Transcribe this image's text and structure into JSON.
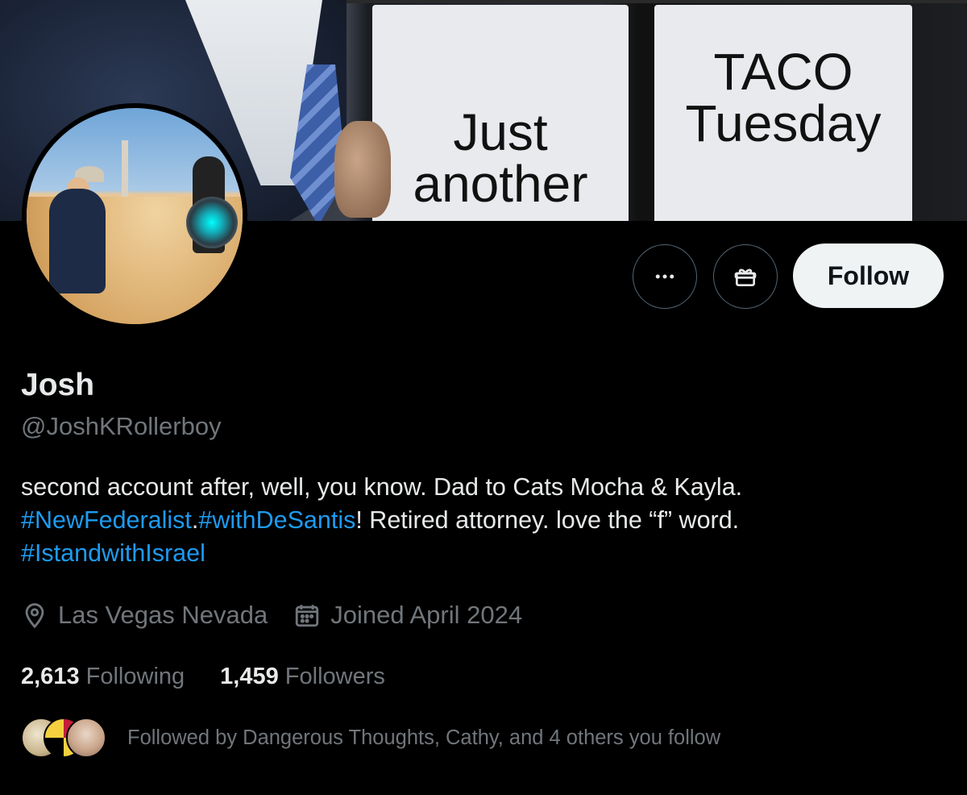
{
  "banner": {
    "sign_left_line1": "Just",
    "sign_left_line2": "another",
    "sign_right_line1": "TACO",
    "sign_right_line2": "Tuesday"
  },
  "actions": {
    "more_icon": "more-horizontal-icon",
    "gift_icon": "gift-icon",
    "follow_label": "Follow"
  },
  "profile": {
    "display_name": "Josh",
    "handle": "@JoshKRollerboy",
    "bio_line1": "second account after, well, you know. Dad to Cats Mocha & Kayla.",
    "bio_tag1": "#NewFederalist",
    "bio_sep": ".",
    "bio_tag2": "#withDeSantis",
    "bio_rest": "! Retired attorney. love the “f” word.",
    "bio_tag3": "#IstandwithIsrael",
    "location": "Las Vegas Nevada",
    "joined": "Joined April 2024"
  },
  "stats": {
    "following_count": "2,613",
    "following_label": "Following",
    "followers_count": "1,459",
    "followers_label": "Followers"
  },
  "followed_by": {
    "text": "Followed by Dangerous Thoughts, Cathy, and 4 others you follow"
  },
  "colors": {
    "background": "#000000",
    "text_primary": "#e7e9ea",
    "text_secondary": "#71767b",
    "link": "#1d9bf0",
    "follow_button_bg": "#eff3f4"
  }
}
